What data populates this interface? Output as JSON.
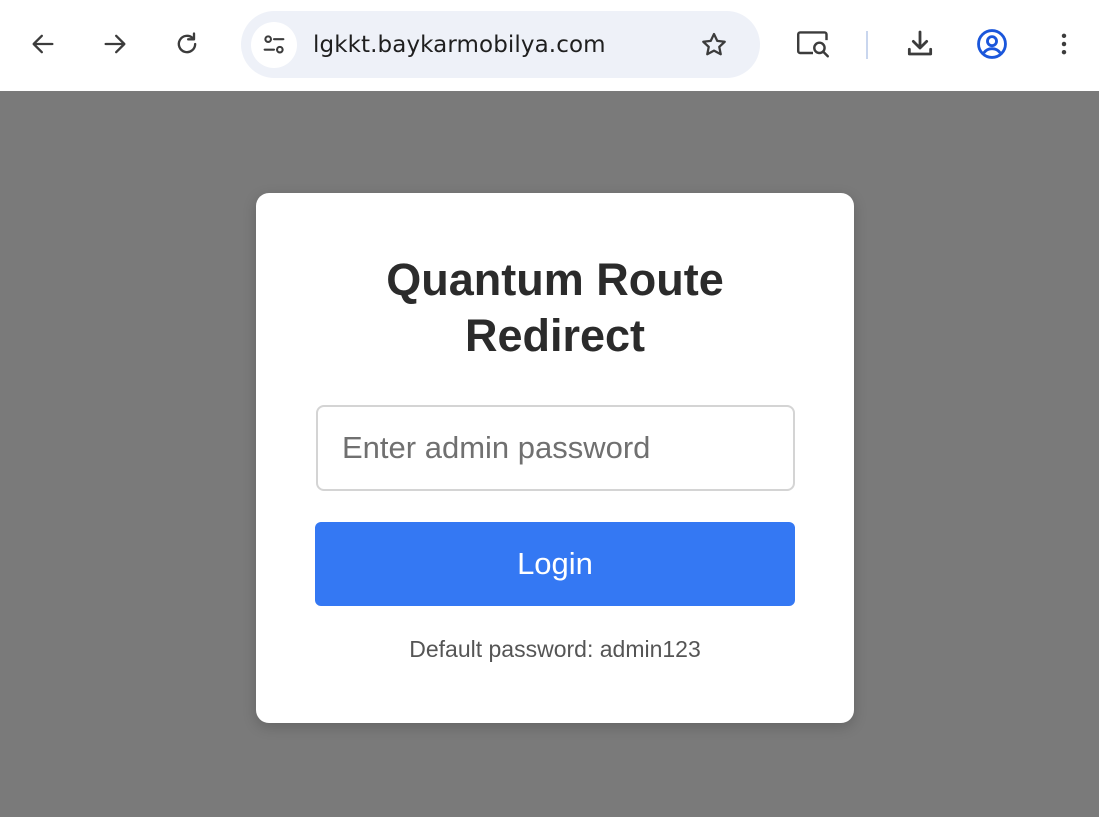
{
  "browser": {
    "url": "lgkkt.baykarmobilya.com",
    "icons": {
      "back": "arrow-left-icon",
      "forward": "arrow-right-icon",
      "reload": "reload-icon",
      "site_info": "tune-icon",
      "bookmark": "star-icon",
      "lens": "search-page-icon",
      "download": "download-icon",
      "profile": "account-circle-icon",
      "menu": "more-vert-icon"
    },
    "colors": {
      "toolbar_bg": "#ffffff",
      "omnibox_bg": "#eef1f8",
      "profile_blue": "#1a56db"
    }
  },
  "login": {
    "title": "Quantum Route Redirect",
    "password_placeholder": "Enter admin password",
    "button_label": "Login",
    "hint": "Default password: admin123",
    "colors": {
      "page_bg": "#7a7a7a",
      "card_bg": "#ffffff",
      "button_bg": "#3478f3",
      "title": "#2b2b2b"
    }
  }
}
